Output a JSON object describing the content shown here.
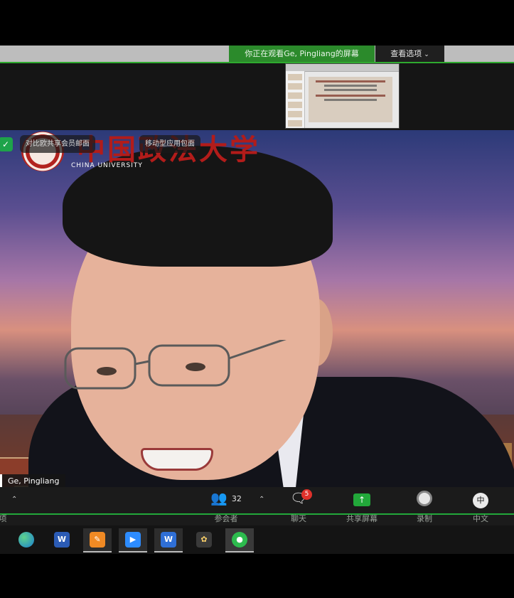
{
  "banner": {
    "viewing_text": "你正在观看Ge, Pingliang的屏幕",
    "view_options_label": "查看选项"
  },
  "video": {
    "university_cn": "中国政法大学",
    "university_en": "CHINA UNIVERSITY",
    "pill_left": "对比欧共享会员邮面",
    "pill_right": "移动型应用包面",
    "participant_name": "Ge, Pingliang"
  },
  "toolbar": {
    "left_label": "项",
    "participants_count": "32",
    "participants_label": "参会者",
    "chat_label": "聊天",
    "chat_badge": "5",
    "share_label": "共享屏幕",
    "record_label": "录制",
    "language_icon_text": "中",
    "language_label": "中文"
  },
  "taskbar": {
    "apps": [
      "Edge",
      "Word",
      "Tool",
      "Zoom",
      "WPS",
      "Photos",
      "WeChat"
    ],
    "word_letter": "W",
    "wps_letter": "W"
  },
  "colors": {
    "accent_green": "#22a83a",
    "badge_red": "#e0312b",
    "logo_red": "#b21c1a"
  }
}
